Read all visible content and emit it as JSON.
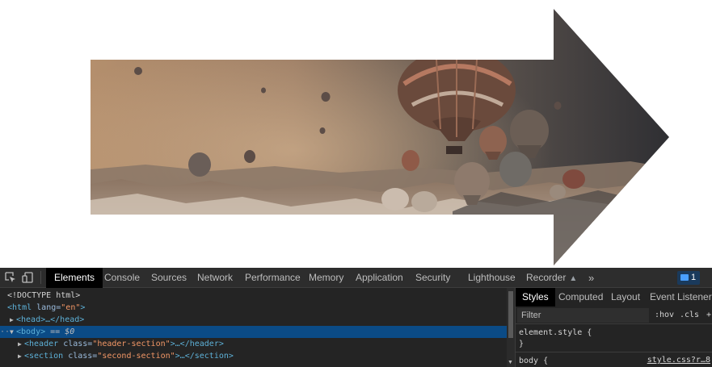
{
  "page": {
    "hero_image": "hot-air-balloons-sepia"
  },
  "devtools": {
    "toolbar": {
      "inspect_icon": "inspect-element-icon",
      "device_icon": "device-toolbar-icon",
      "tabs": [
        "Elements",
        "Console",
        "Sources",
        "Network",
        "Performance",
        "Memory",
        "Application",
        "Security",
        "Lighthouse",
        "Recorder"
      ],
      "active_tab": "Elements",
      "more_tabs": "»",
      "issues_count": "1"
    },
    "dom": {
      "doctype": "<!DOCTYPE html>",
      "html_tag": "html",
      "html_attr": "lang",
      "html_val": "\"en\"",
      "head": "<head>…</head>",
      "body": "<body>",
      "body_suffix": "== $0",
      "header_tag": "<header",
      "header_attr": "class=",
      "header_val": "\"header-section\"",
      "header_end": ">…</header>",
      "section_tag": "<section",
      "section_attr": "class=",
      "section_val": "\"second-section\"",
      "section_end": ">…</section>",
      "dots": "···"
    },
    "styles": {
      "tabs": [
        "Styles",
        "Computed",
        "Layout",
        "Event Listeners"
      ],
      "active_tab": "Styles",
      "filter_placeholder": "Filter",
      "hov": ":hov",
      "cls": ".cls",
      "plus": "+",
      "element_style": "element.style {",
      "element_style_close": "}",
      "body_rule": "body {",
      "body_link": "style.css?r…8"
    }
  }
}
